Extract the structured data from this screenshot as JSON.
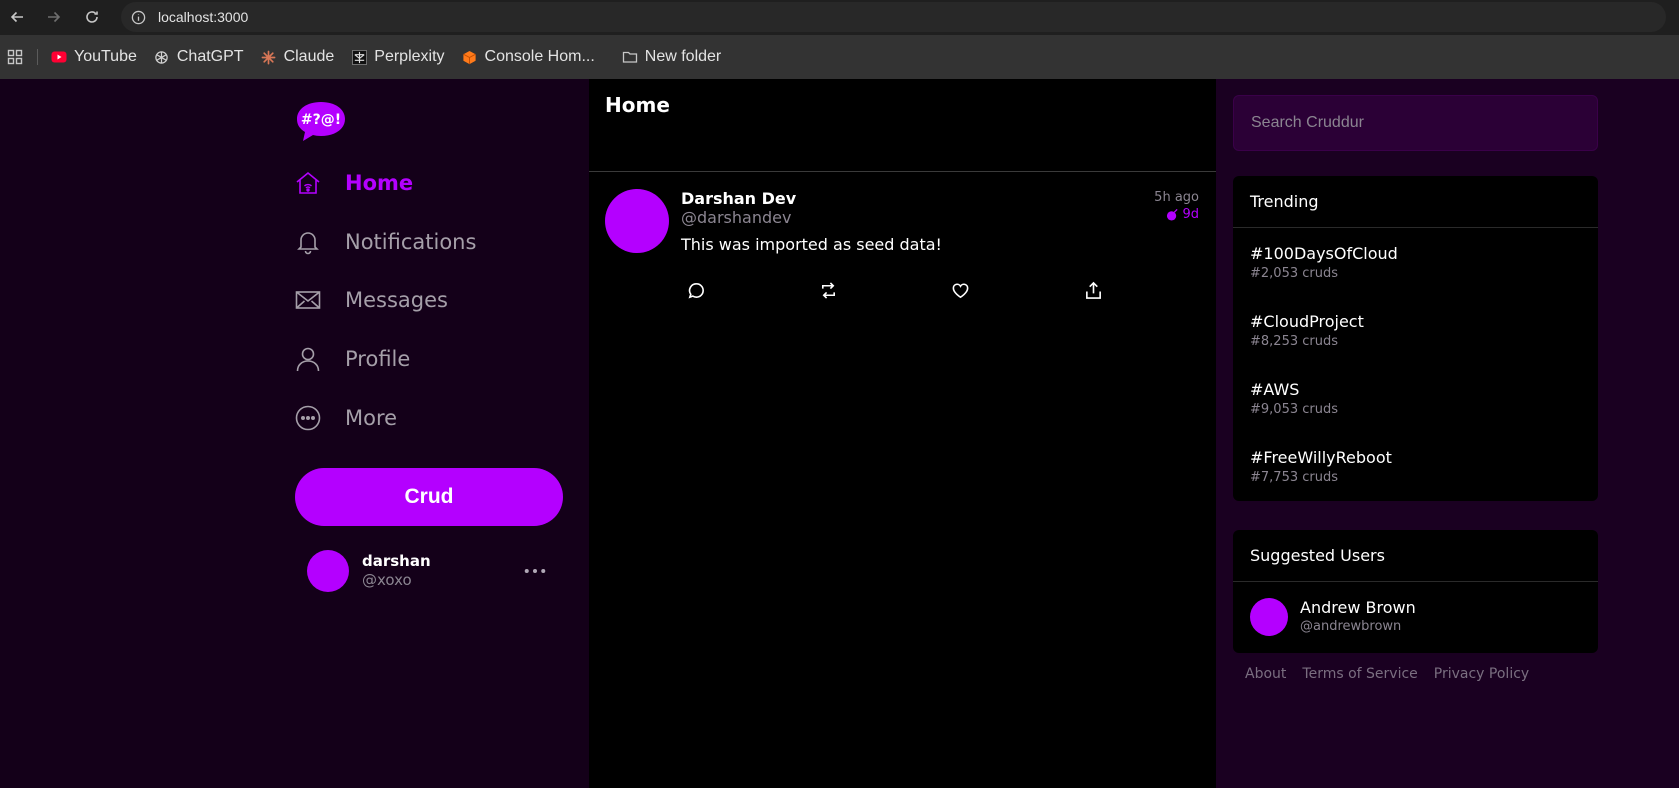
{
  "browser": {
    "url": "localhost:3000",
    "bookmarks": [
      {
        "label": "YouTube",
        "icon": "youtube-icon"
      },
      {
        "label": "ChatGPT",
        "icon": "chatgpt-icon"
      },
      {
        "label": "Claude",
        "icon": "claude-icon"
      },
      {
        "label": "Perplexity",
        "icon": "perplexity-icon"
      },
      {
        "label": "Console Hom...",
        "icon": "aws-console-icon"
      },
      {
        "label": "New folder",
        "icon": "folder-icon"
      }
    ]
  },
  "app": {
    "logo_text": "#?@!",
    "accent_color": "#b400ff",
    "nav": [
      {
        "label": "Home",
        "icon": "home-icon",
        "active": true
      },
      {
        "label": "Notifications",
        "icon": "bell-icon",
        "active": false
      },
      {
        "label": "Messages",
        "icon": "envelope-icon",
        "active": false
      },
      {
        "label": "Profile",
        "icon": "person-icon",
        "active": false
      },
      {
        "label": "More",
        "icon": "more-circle-icon",
        "active": false
      }
    ],
    "crud_button": "Crud",
    "current_user": {
      "name": "darshan",
      "handle": "@xoxo"
    }
  },
  "feed": {
    "title": "Home",
    "posts": [
      {
        "display_name": "Darshan Dev",
        "handle": "@darshandev",
        "time_ago": "5h ago",
        "expires_in": "9d",
        "message": "This was imported as seed data!"
      }
    ]
  },
  "sidebar": {
    "search_placeholder": "Search Cruddur",
    "trending_title": "Trending",
    "trending": [
      {
        "tag": "#100DaysOfCloud",
        "count": "#2,053 cruds"
      },
      {
        "tag": "#CloudProject",
        "count": "#8,253 cruds"
      },
      {
        "tag": "#AWS",
        "count": "#9,053 cruds"
      },
      {
        "tag": "#FreeWillyReboot",
        "count": "#7,753 cruds"
      }
    ],
    "suggested_title": "Suggested Users",
    "suggested": [
      {
        "name": "Andrew Brown",
        "handle": "@andrewbrown"
      }
    ],
    "footer": [
      "About",
      "Terms of Service",
      "Privacy Policy"
    ]
  }
}
